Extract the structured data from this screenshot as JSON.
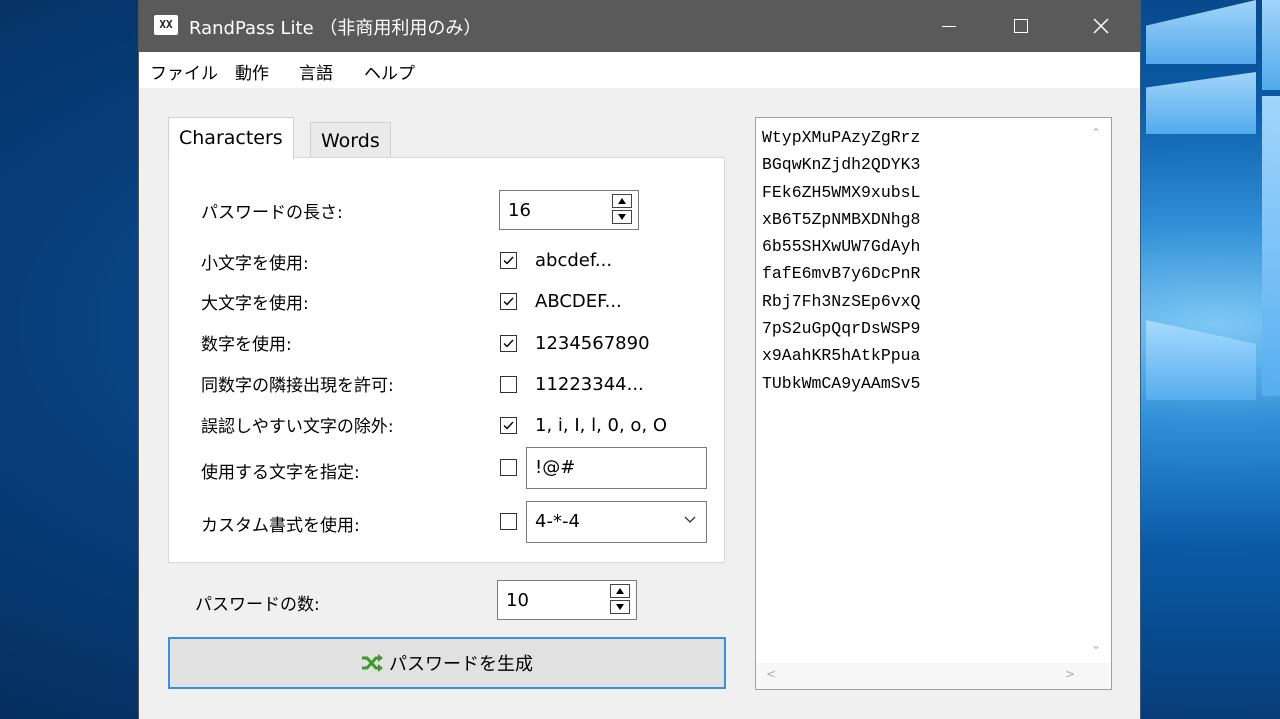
{
  "window": {
    "app_icon": "XX",
    "title": "RandPass Lite （非商用利用のみ）"
  },
  "menu": [
    "ファイル",
    "動作",
    "言語",
    "ヘルプ"
  ],
  "tabs": [
    "Characters",
    "Words"
  ],
  "settings": {
    "length_label": "パスワードの長さ:",
    "length_value": "16",
    "lowercase_label": "小文字を使用:",
    "lowercase_checked": true,
    "lowercase_text": "abcdef...",
    "uppercase_label": "大文字を使用:",
    "uppercase_checked": true,
    "uppercase_text": "ABCDEF...",
    "digits_label": "数字を使用:",
    "digits_checked": true,
    "digits_text": "1234567890",
    "repeat_label": "同数字の隣接出現を許可:",
    "repeat_checked": false,
    "repeat_text": "11223344...",
    "exclude_label": "誤認しやすい文字の除外:",
    "exclude_checked": true,
    "exclude_text": "1, i, I, l, 0, o, O",
    "custom_chars_label": "使用する文字を指定:",
    "custom_chars_checked": false,
    "custom_chars_value": "!@#",
    "format_label": "カスタム書式を使用:",
    "format_checked": false,
    "format_value": "4-*-4"
  },
  "count_label": "パスワードの数:",
  "count_value": "10",
  "generate_label": "パスワードを生成",
  "passwords": [
    "WtypXMuPAzyZgRrz",
    "BGqwKnZjdh2QDYK3",
    "FEk6ZH5WMX9xubsL",
    "xB6T5ZpNMBXDNhg8",
    "6b55SHXwUW7GdAyh",
    "fafE6mvB7y6DcPnR",
    "Rbj7Fh3NzSEp6vxQ",
    "7pS2uGpQqrDsWSP9",
    "x9AahKR5hAtkPpua",
    "TUbkWmCA9yAAmSv5"
  ]
}
